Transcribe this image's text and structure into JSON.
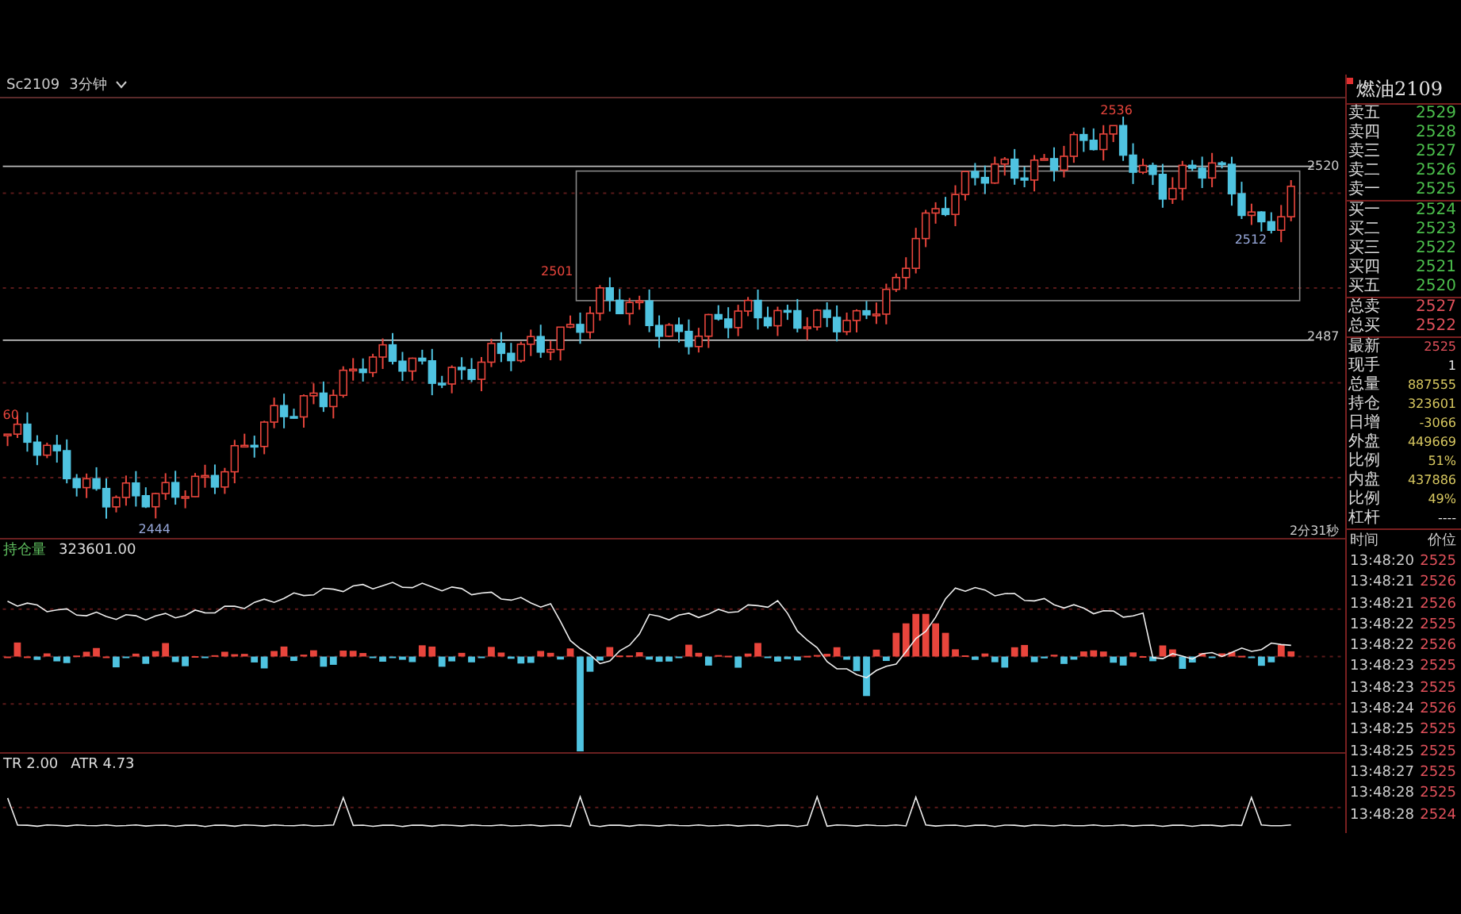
{
  "header": {
    "symbol": "Sc2109",
    "period": "3分钟"
  },
  "chart_labels": [
    {
      "text": "60"
    },
    {
      "text": "2444"
    },
    {
      "text": "2501"
    },
    {
      "text": "2536"
    },
    {
      "text": "2512"
    },
    {
      "text": "2520"
    },
    {
      "text": "2487"
    },
    {
      "text": "2分31秒"
    }
  ],
  "indicator": {
    "name": "持仓量",
    "value": "323601.00"
  },
  "atr": {
    "tr": "TR 2.00",
    "atr": "ATR 4.73"
  },
  "panel": {
    "title": "燃油2109",
    "asks": [
      {
        "label": "卖五",
        "price": "2529"
      },
      {
        "label": "卖四",
        "price": "2528"
      },
      {
        "label": "卖三",
        "price": "2527"
      },
      {
        "label": "卖二",
        "price": "2526"
      },
      {
        "label": "卖一",
        "price": "2525"
      }
    ],
    "bids": [
      {
        "label": "买一",
        "price": "2524"
      },
      {
        "label": "买二",
        "price": "2523"
      },
      {
        "label": "买三",
        "price": "2522"
      },
      {
        "label": "买四",
        "price": "2521"
      },
      {
        "label": "买五",
        "price": "2520"
      }
    ],
    "totals": [
      {
        "label": "总卖",
        "price": "2527"
      },
      {
        "label": "总买",
        "price": "2522"
      }
    ],
    "quote": [
      {
        "label": "最新",
        "value": "2525",
        "color": "#e0505a"
      },
      {
        "label": "现手",
        "value": "1",
        "color": "#e8e8e8"
      },
      {
        "label": "总量",
        "value": "887555",
        "color": "#d8c860"
      },
      {
        "label": "持仓",
        "value": "323601",
        "color": "#d8c860"
      },
      {
        "label": "日增",
        "value": "-3066",
        "color": "#d8c860"
      },
      {
        "label": "外盘",
        "value": "449669",
        "color": "#d8c860"
      },
      {
        "label": "比例",
        "value": "51%",
        "color": "#d8c860"
      },
      {
        "label": "内盘",
        "value": "437886",
        "color": "#d8c860"
      },
      {
        "label": "比例",
        "value": "49%",
        "color": "#d8c860"
      },
      {
        "label": "杠杆",
        "value": "----",
        "color": "#e8e8e8"
      }
    ],
    "ticks_header": {
      "time": "时间",
      "price": "价位"
    },
    "ticks": [
      {
        "time": "13:48:20",
        "price": "2525"
      },
      {
        "time": "13:48:21",
        "price": "2526"
      },
      {
        "time": "13:48:21",
        "price": "2526"
      },
      {
        "time": "13:48:22",
        "price": "2525"
      },
      {
        "time": "13:48:22",
        "price": "2526"
      },
      {
        "time": "13:48:23",
        "price": "2525"
      },
      {
        "time": "13:48:23",
        "price": "2525"
      },
      {
        "time": "13:48:24",
        "price": "2526"
      },
      {
        "time": "13:48:25",
        "price": "2525"
      },
      {
        "time": "13:48:25",
        "price": "2525"
      },
      {
        "time": "13:48:27",
        "price": "2525"
      },
      {
        "time": "13:48:28",
        "price": "2525"
      },
      {
        "time": "13:48:28",
        "price": "2524"
      }
    ]
  }
}
